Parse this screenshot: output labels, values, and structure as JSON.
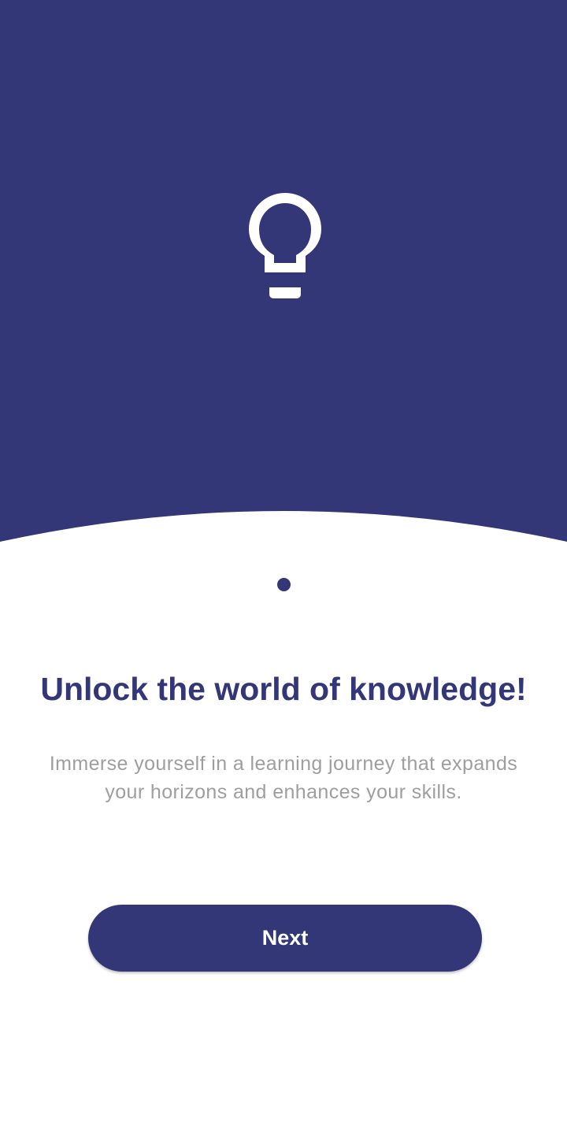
{
  "theme": {
    "primary_color": "#333677",
    "background_color": "#ffffff",
    "description_color": "#9e9e9e"
  },
  "hero": {
    "icon": "lightbulb-icon"
  },
  "onboarding": {
    "pages_total": 1,
    "current_page": 1,
    "title": "Unlock the world of knowledge!",
    "description": "Immerse yourself in a learning journey that expands your horizons and enhances your skills.",
    "next_label": "Next"
  }
}
